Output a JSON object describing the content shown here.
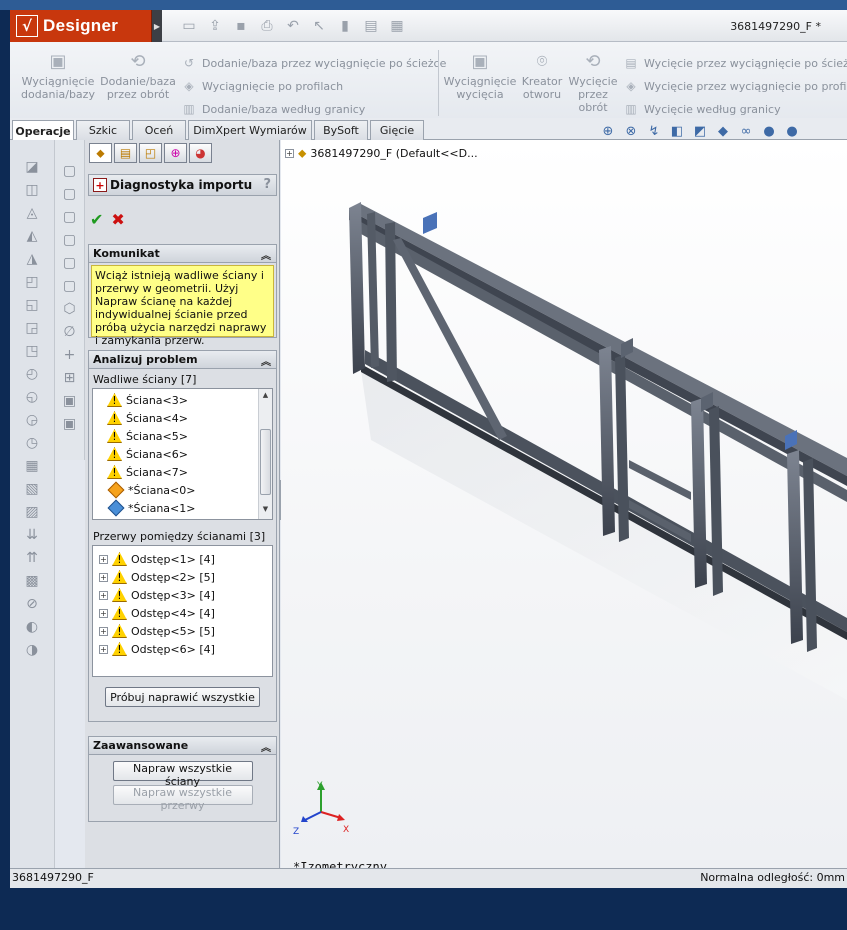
{
  "app": {
    "name": "Designer",
    "doc_title": "3681497290_F *"
  },
  "ribbon": {
    "extrude_boss": "Wyciągnięcie dodania/bazy",
    "revolve_boss": "Dodanie/baza przez obrót",
    "sweep_boss": "Dodanie/baza przez wyciągnięcie po ścieżce",
    "loft_boss": "Wyciągnięcie po profilach",
    "boundary_boss": "Dodanie/baza według granicy",
    "extrude_cut": "Wyciągnięcie wycięcia",
    "hole_wizard": "Kreator otworu",
    "revolve_cut": "Wycięcie przez obrót",
    "sweep_cut": "Wycięcie przez wyciągnięcie po ścieżce",
    "loft_cut": "Wycięcie przez wyciągnięcie po profilach",
    "boundary_cut": "Wycięcie według granicy"
  },
  "tabs": [
    "Operacje",
    "Szkic",
    "Oceń",
    "DimXpert Wymiarów",
    "BySoft",
    "Gięcie"
  ],
  "property_manager": {
    "title": "Diagnostyka importu",
    "help": "?",
    "message_header": "Komunikat",
    "message": "Wciąż istnieją wadliwe ściany i przerwy w geometrii. Użyj Napraw ścianę na każdej indywidualnej ścianie przed próbą użycia narzędzi naprawy i zamykania przerw.",
    "analyze_header": "Analizuj problem",
    "faulty_faces_label": "Wadliwe ściany [7]",
    "faces": [
      "Ściana<3>",
      "Ściana<4>",
      "Ściana<5>",
      "Ściana<6>",
      "Ściana<7>",
      "*Ściana<0>",
      "*Ściana<1>"
    ],
    "gaps_label": "Przerwy pomiędzy ścianami [3]",
    "gaps": [
      "Odstęp<1> [4]",
      "Odstęp<2> [5]",
      "Odstęp<3> [4]",
      "Odstęp<4> [4]",
      "Odstęp<5> [5]",
      "Odstęp<6> [4]"
    ],
    "try_fix_all": "Próbuj naprawić wszystkie",
    "advanced_header": "Zaawansowane",
    "fix_all_faces": "Napraw wszystkie ściany",
    "fix_all_gaps": "Napraw wszystkie przerwy"
  },
  "viewport": {
    "tree_item": "3681497290_F  (Default<<D...",
    "view_name": "*Izometryczny",
    "axis_x": "X",
    "axis_y": "Y",
    "axis_z": "Z"
  },
  "status": {
    "left": "3681497290_F",
    "right": "Normalna odległość: 0mm"
  }
}
